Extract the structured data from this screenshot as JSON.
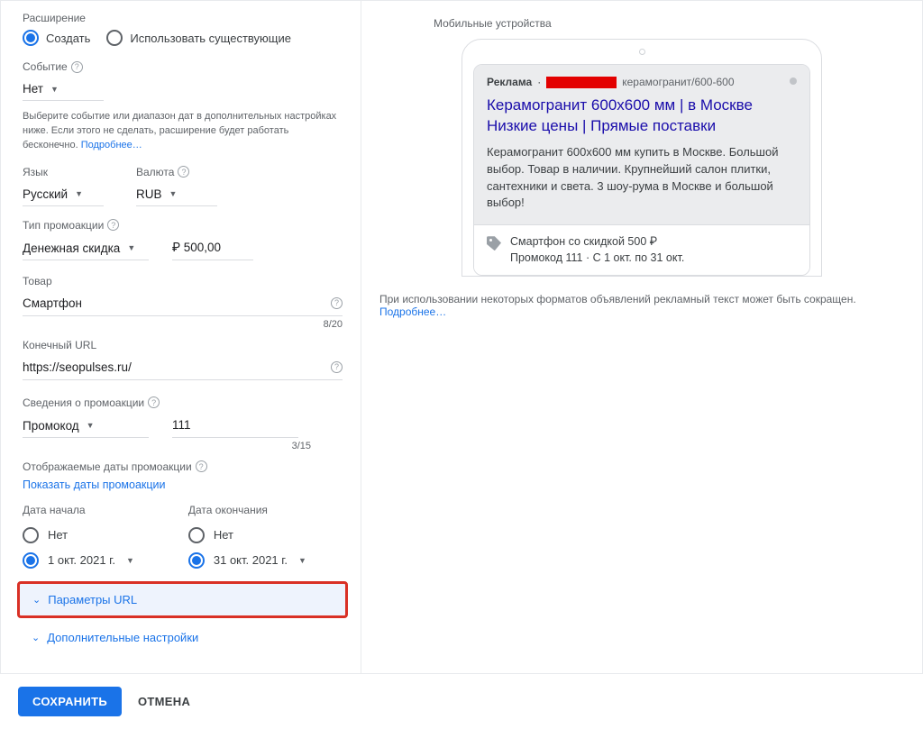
{
  "left": {
    "extension_label": "Расширение",
    "radio_create": "Создать",
    "radio_existing": "Использовать существующие",
    "event_label": "Событие",
    "event_value": "Нет",
    "hint1": "Выберите событие или диапазон дат в дополнительных настройках ниже. Если этого не сделать, расширение будет работать бесконечно.",
    "hint_more": "Подробнее…",
    "lang_label": "Язык",
    "lang_value": "Русский",
    "currency_label": "Валюта",
    "currency_value": "RUB",
    "promo_type_label": "Тип промоакции",
    "promo_type_value": "Денежная скидка",
    "promo_amount": "₽ 500,00",
    "product_label": "Товар",
    "product_value": "Смартфон",
    "product_counter": "8/20",
    "url_label": "Конечный URL",
    "url_value": "https://seopulses.ru/",
    "promo_details_label": "Сведения о промоакции",
    "promo_details_value": "Промокод",
    "promo_code": "111",
    "promo_code_counter": "3/15",
    "shown_dates_label": "Отображаемые даты промоакции",
    "show_dates_link": "Показать даты промоакции",
    "date_start_label": "Дата начала",
    "date_end_label": "Дата окончания",
    "date_none": "Нет",
    "date_start_value": "1 окт. 2021 г.",
    "date_end_value": "31 окт. 2021 г.",
    "expand_url_params": "Параметры URL",
    "expand_advanced": "Дополнительные настройки"
  },
  "right": {
    "preview_title": "Мобильные устройства",
    "ad_label": "Реклама",
    "ad_breadcrumb": "керамогранит/600-600",
    "ad_title": "Керамогранит 600x600 мм | в Москве Низкие цены | Прямые поставки",
    "ad_desc": "Керамогранит 600x600 мм купить в Москве. Большой выбор. Товар в наличии. Крупнейший салон плитки, сантехники и света. 3 шоу-рума в Москве и большой выбор!",
    "promo_line1": "Смартфон со скидкой 500 ₽",
    "promo_line2": "Промокод 111  ·  С 1 окт. по 31 окт.",
    "note": "При использовании некоторых форматов объявлений рекламный текст может быть сокращен.",
    "note_more": "Подробнее…"
  },
  "footer": {
    "save": "СОХРАНИТЬ",
    "cancel": "ОТМЕНА"
  }
}
